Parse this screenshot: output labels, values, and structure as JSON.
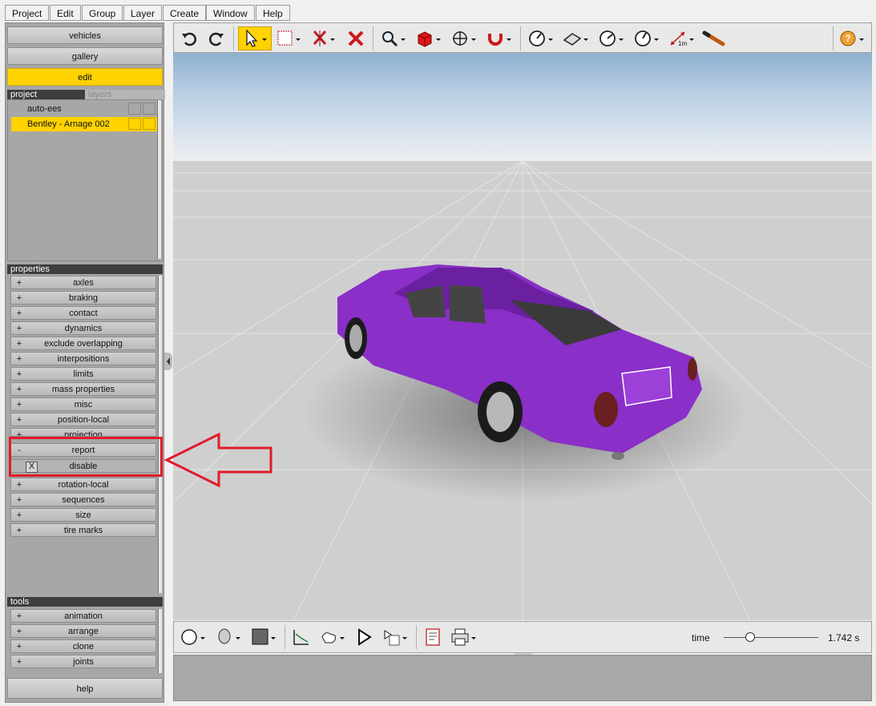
{
  "menu": {
    "project": "Project",
    "edit": "Edit",
    "group": "Group",
    "layer": "Layer",
    "create": "Create",
    "window": "Window",
    "help": "Help"
  },
  "nav": {
    "vehicles": "vehicles",
    "gallery": "gallery",
    "edit": "edit",
    "help": "help"
  },
  "project_panel": {
    "tab_project": "project",
    "tab_layers": "layers",
    "items": [
      {
        "label": "auto-ees"
      },
      {
        "label": "Bentley - Arnage 002"
      }
    ]
  },
  "properties": {
    "header": "properties",
    "items": [
      {
        "label": "axles",
        "expander": "+"
      },
      {
        "label": "braking",
        "expander": "+"
      },
      {
        "label": "contact",
        "expander": "+"
      },
      {
        "label": "dynamics",
        "expander": "+"
      },
      {
        "label": "exclude overlapping",
        "expander": "+"
      },
      {
        "label": "interpositions",
        "expander": "+"
      },
      {
        "label": "limits",
        "expander": "+"
      },
      {
        "label": "mass properties",
        "expander": "+"
      },
      {
        "label": "misc",
        "expander": "+"
      },
      {
        "label": "position-local",
        "expander": "+"
      },
      {
        "label": "projection",
        "expander": "+"
      },
      {
        "label": "report",
        "expander": "-"
      },
      {
        "label": "rotation-local",
        "expander": "+"
      },
      {
        "label": "sequences",
        "expander": "+"
      },
      {
        "label": "size",
        "expander": "+"
      },
      {
        "label": "tire marks",
        "expander": "+"
      }
    ],
    "report_child": {
      "label": "disable",
      "checkbox": "X"
    }
  },
  "tools": {
    "header": "tools",
    "items": [
      {
        "label": "animation",
        "expander": "+"
      },
      {
        "label": "arrange",
        "expander": "+"
      },
      {
        "label": "clone",
        "expander": "+"
      },
      {
        "label": "joints",
        "expander": "+"
      }
    ]
  },
  "toolbar": {
    "icons": [
      "undo-icon",
      "redo-icon",
      "select-arrow-icon",
      "select-box-icon",
      "delete-selected-icon",
      "delete-icon",
      "zoom-icon",
      "create-cube-icon",
      "move-icon",
      "magnet-icon",
      "camera-dial-icon",
      "plane-icon",
      "rotate-dial-icon",
      "speed-dial-icon",
      "measure-icon",
      "pencil-tool-icon",
      "help-icon"
    ],
    "measure_label": "1m"
  },
  "bottombar": {
    "icons": [
      "sphere-icon",
      "head-icon",
      "color-swatch-icon",
      "graph-icon",
      "hand-icon",
      "play-icon",
      "sequence-icon",
      "report-doc-icon",
      "print-icon"
    ],
    "time_label": "time",
    "time_value": "1.742 s",
    "slider_fraction": 0.28
  },
  "colors": {
    "accent": "#ffd200",
    "car": "#8a2fc8",
    "highlight_box": "#e21a2a"
  }
}
